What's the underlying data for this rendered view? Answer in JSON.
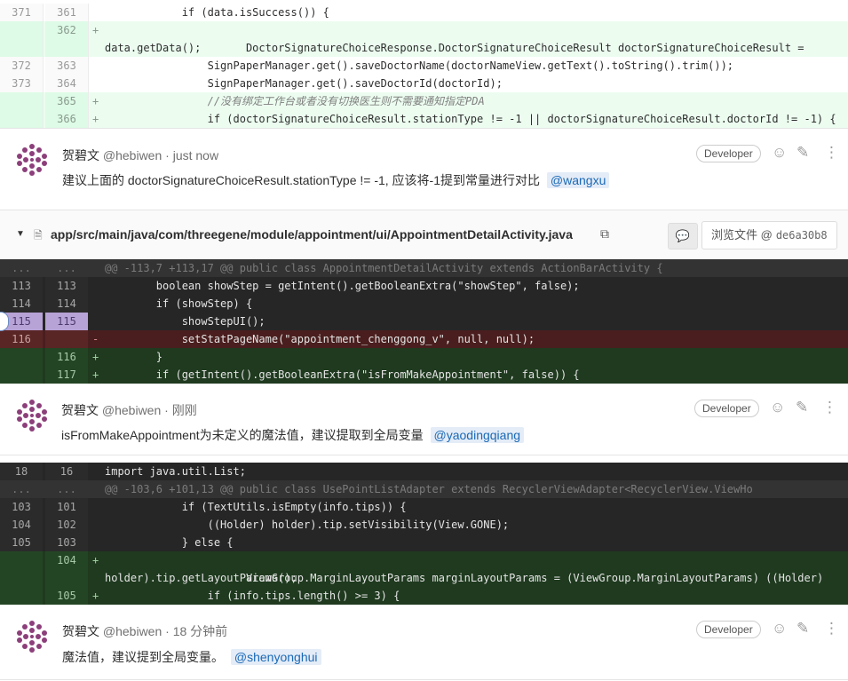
{
  "diff1": {
    "lines": [
      {
        "type": "ctx",
        "old": "371",
        "new": "361",
        "sign": "",
        "code": "            if (data.isSuccess()) {"
      },
      {
        "type": "add",
        "old": "",
        "new": "362",
        "sign": "+",
        "code": "                DoctorSignatureChoiceResponse.DoctorSignatureChoiceResult doctorSignatureChoiceResult =",
        "cont": "data.getData();"
      },
      {
        "type": "ctx",
        "old": "372",
        "new": "363",
        "sign": "",
        "code": "                SignPaperManager.get().saveDoctorName(doctorNameView.getText().toString().trim());"
      },
      {
        "type": "ctx",
        "old": "373",
        "new": "364",
        "sign": "",
        "code": "                SignPaperManager.get().saveDoctorId(doctorId);"
      },
      {
        "type": "add",
        "old": "",
        "new": "365",
        "sign": "+",
        "code": "                //没有绑定工作台或者没有切换医生则不需要通知指定PDA"
      },
      {
        "type": "add",
        "old": "",
        "new": "366",
        "sign": "+",
        "code": "                if (doctorSignatureChoiceResult.stationType != -1 || doctorSignatureChoiceResult.doctorId != -1) {"
      }
    ]
  },
  "note1": {
    "author": "贺碧文",
    "username": "@hebiwen",
    "time": "just now",
    "badge": "Developer",
    "text": "建议上面的 doctorSignatureChoiceResult.stationType != -1, 应该将-1提到常量进行对比",
    "mention": "@wangxu"
  },
  "file_header": {
    "toggle_icon": "caret-down",
    "path": "app/src/main/java/com/threegene/module/appointment/ui/AppointmentDetailActivity.java",
    "view_label": "浏览文件 @",
    "sha": "de6a30b8"
  },
  "diff2": {
    "lines": [
      {
        "type": "meta",
        "old": "...",
        "new": "...",
        "sign": "",
        "code": "@@ -113,7 +113,17 @@ public class AppointmentDetailActivity extends ActionBarActivity {"
      },
      {
        "type": "ctx",
        "old": "113",
        "new": "113",
        "sign": "",
        "code": "        boolean showStep = getIntent().getBooleanExtra(\"showStep\", false);"
      },
      {
        "type": "ctx",
        "old": "114",
        "new": "114",
        "sign": "",
        "code": "        if (showStep) {"
      },
      {
        "type": "hl",
        "old": "115",
        "new": "115",
        "sign": "",
        "code": "            showStepUI();"
      },
      {
        "type": "del",
        "old": "116",
        "new": "",
        "sign": "-",
        "code": "            setStatPageName(\"appointment_chenggong_v\", null, null);"
      },
      {
        "type": "add",
        "old": "",
        "new": "116",
        "sign": "+",
        "code": "        }"
      },
      {
        "type": "add",
        "old": "",
        "new": "117",
        "sign": "+",
        "code": "        if (getIntent().getBooleanExtra(\"isFromMakeAppointment\", false)) {"
      }
    ]
  },
  "note2": {
    "author": "贺碧文",
    "username": "@hebiwen",
    "time": "刚刚",
    "badge": "Developer",
    "text": "isFromMakeAppointment为未定义的魔法值，建议提取到全局变量",
    "mention": "@yaodingqiang"
  },
  "diff3": {
    "lines": [
      {
        "type": "ctx",
        "old": "18",
        "new": "16",
        "sign": "",
        "code": "import java.util.List;"
      },
      {
        "type": "meta",
        "old": "...",
        "new": "...",
        "sign": "",
        "code": "@@ -103,6 +101,13 @@ public class UsePointListAdapter extends RecyclerViewAdapter<RecyclerView.ViewHo"
      },
      {
        "type": "ctx",
        "old": "103",
        "new": "101",
        "sign": "",
        "code": "            if (TextUtils.isEmpty(info.tips)) {"
      },
      {
        "type": "ctx",
        "old": "104",
        "new": "102",
        "sign": "",
        "code": "                ((Holder) holder).tip.setVisibility(View.GONE);"
      },
      {
        "type": "ctx",
        "old": "105",
        "new": "103",
        "sign": "",
        "code": "            } else {"
      },
      {
        "type": "add",
        "old": "",
        "new": "104",
        "sign": "+",
        "code": "                ViewGroup.MarginLayoutParams marginLayoutParams = (ViewGroup.MarginLayoutParams) ((Holder)",
        "cont": "holder).tip.getLayoutParams();"
      },
      {
        "type": "add",
        "old": "",
        "new": "105",
        "sign": "+",
        "code": "                if (info.tips.length() >= 3) {"
      }
    ]
  },
  "note3": {
    "author": "贺碧文",
    "username": "@hebiwen",
    "time": "18 分钟前",
    "badge": "Developer",
    "text": "魔法值，建议提到全局变量。",
    "mention": "@shenyonghui"
  },
  "icons": {
    "emoji": "smiley-icon",
    "edit": "pencil-icon",
    "more": "kebab-icon",
    "copy": "copy-icon",
    "comment": "comment-icon",
    "file": "file-icon"
  }
}
